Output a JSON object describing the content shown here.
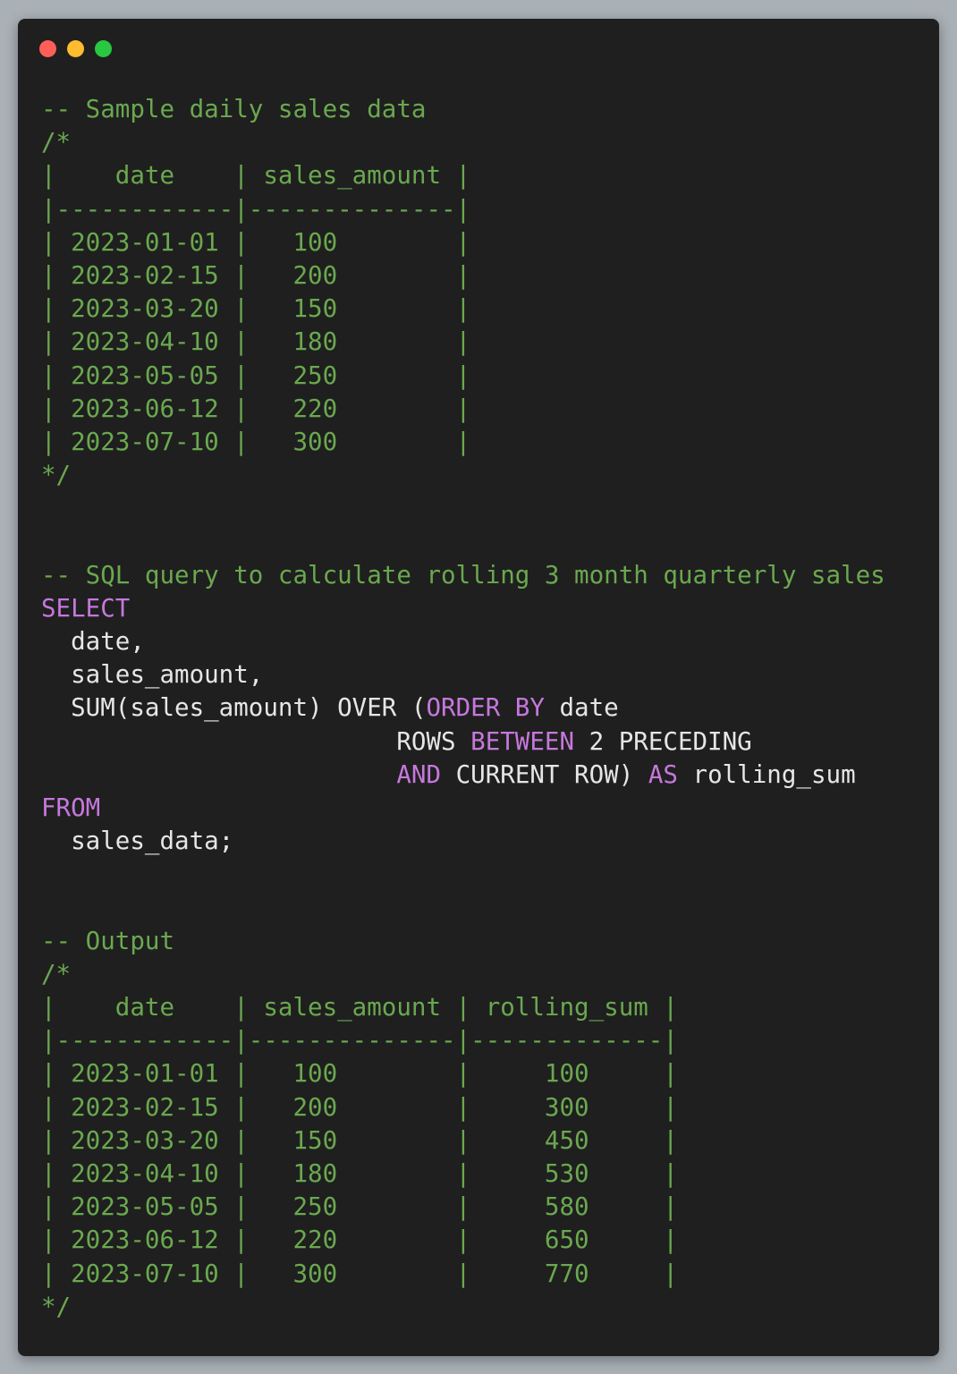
{
  "window": {
    "controls": [
      {
        "name": "close-dot",
        "color": "#ff5f57"
      },
      {
        "name": "minimize-dot",
        "color": "#febc2e"
      },
      {
        "name": "maximize-dot",
        "color": "#28c840"
      }
    ]
  },
  "colors": {
    "comment": "#6aa84f",
    "keyword": "#c678dd",
    "text": "#e6e6e6",
    "background": "#1f1f1f"
  },
  "code_lines": [
    [
      {
        "t": "c",
        "v": "-- Sample daily sales data"
      }
    ],
    [
      {
        "t": "c",
        "v": "/*"
      }
    ],
    [
      {
        "t": "c",
        "v": "|    date    | sales_amount |"
      }
    ],
    [
      {
        "t": "c",
        "v": "|------------|--------------|"
      }
    ],
    [
      {
        "t": "c",
        "v": "| 2023-01-01 |   100        |"
      }
    ],
    [
      {
        "t": "c",
        "v": "| 2023-02-15 |   200        |"
      }
    ],
    [
      {
        "t": "c",
        "v": "| 2023-03-20 |   150        |"
      }
    ],
    [
      {
        "t": "c",
        "v": "| 2023-04-10 |   180        |"
      }
    ],
    [
      {
        "t": "c",
        "v": "| 2023-05-05 |   250        |"
      }
    ],
    [
      {
        "t": "c",
        "v": "| 2023-06-12 |   220        |"
      }
    ],
    [
      {
        "t": "c",
        "v": "| 2023-07-10 |   300        |"
      }
    ],
    [
      {
        "t": "c",
        "v": "*/"
      }
    ],
    [],
    [],
    [
      {
        "t": "c",
        "v": "-- SQL query to calculate rolling 3 month quarterly sales"
      }
    ],
    [
      {
        "t": "k",
        "v": "SELECT"
      }
    ],
    [
      {
        "t": "p",
        "v": "  date,"
      }
    ],
    [
      {
        "t": "p",
        "v": "  sales_amount,"
      }
    ],
    [
      {
        "t": "p",
        "v": "  SUM(sales_amount) OVER ("
      },
      {
        "t": "k",
        "v": "ORDER BY"
      },
      {
        "t": "p",
        "v": " date"
      }
    ],
    [
      {
        "t": "p",
        "v": "                        ROWS "
      },
      {
        "t": "k",
        "v": "BETWEEN"
      },
      {
        "t": "p",
        "v": " 2 PRECEDING"
      }
    ],
    [
      {
        "t": "p",
        "v": "                        "
      },
      {
        "t": "k",
        "v": "AND"
      },
      {
        "t": "p",
        "v": " CURRENT ROW) "
      },
      {
        "t": "k",
        "v": "AS"
      },
      {
        "t": "p",
        "v": " rolling_sum"
      }
    ],
    [
      {
        "t": "k",
        "v": "FROM"
      }
    ],
    [
      {
        "t": "p",
        "v": "  sales_data;"
      }
    ],
    [],
    [],
    [
      {
        "t": "c",
        "v": "-- Output"
      }
    ],
    [
      {
        "t": "c",
        "v": "/*"
      }
    ],
    [
      {
        "t": "c",
        "v": "|    date    | sales_amount | rolling_sum |"
      }
    ],
    [
      {
        "t": "c",
        "v": "|------------|--------------|-------------|"
      }
    ],
    [
      {
        "t": "c",
        "v": "| 2023-01-01 |   100        |     100     |"
      }
    ],
    [
      {
        "t": "c",
        "v": "| 2023-02-15 |   200        |     300     |"
      }
    ],
    [
      {
        "t": "c",
        "v": "| 2023-03-20 |   150        |     450     |"
      }
    ],
    [
      {
        "t": "c",
        "v": "| 2023-04-10 |   180        |     530     |"
      }
    ],
    [
      {
        "t": "c",
        "v": "| 2023-05-05 |   250        |     580     |"
      }
    ],
    [
      {
        "t": "c",
        "v": "| 2023-06-12 |   220        |     650     |"
      }
    ],
    [
      {
        "t": "c",
        "v": "| 2023-07-10 |   300        |     770     |"
      }
    ],
    [
      {
        "t": "c",
        "v": "*/"
      }
    ]
  ]
}
